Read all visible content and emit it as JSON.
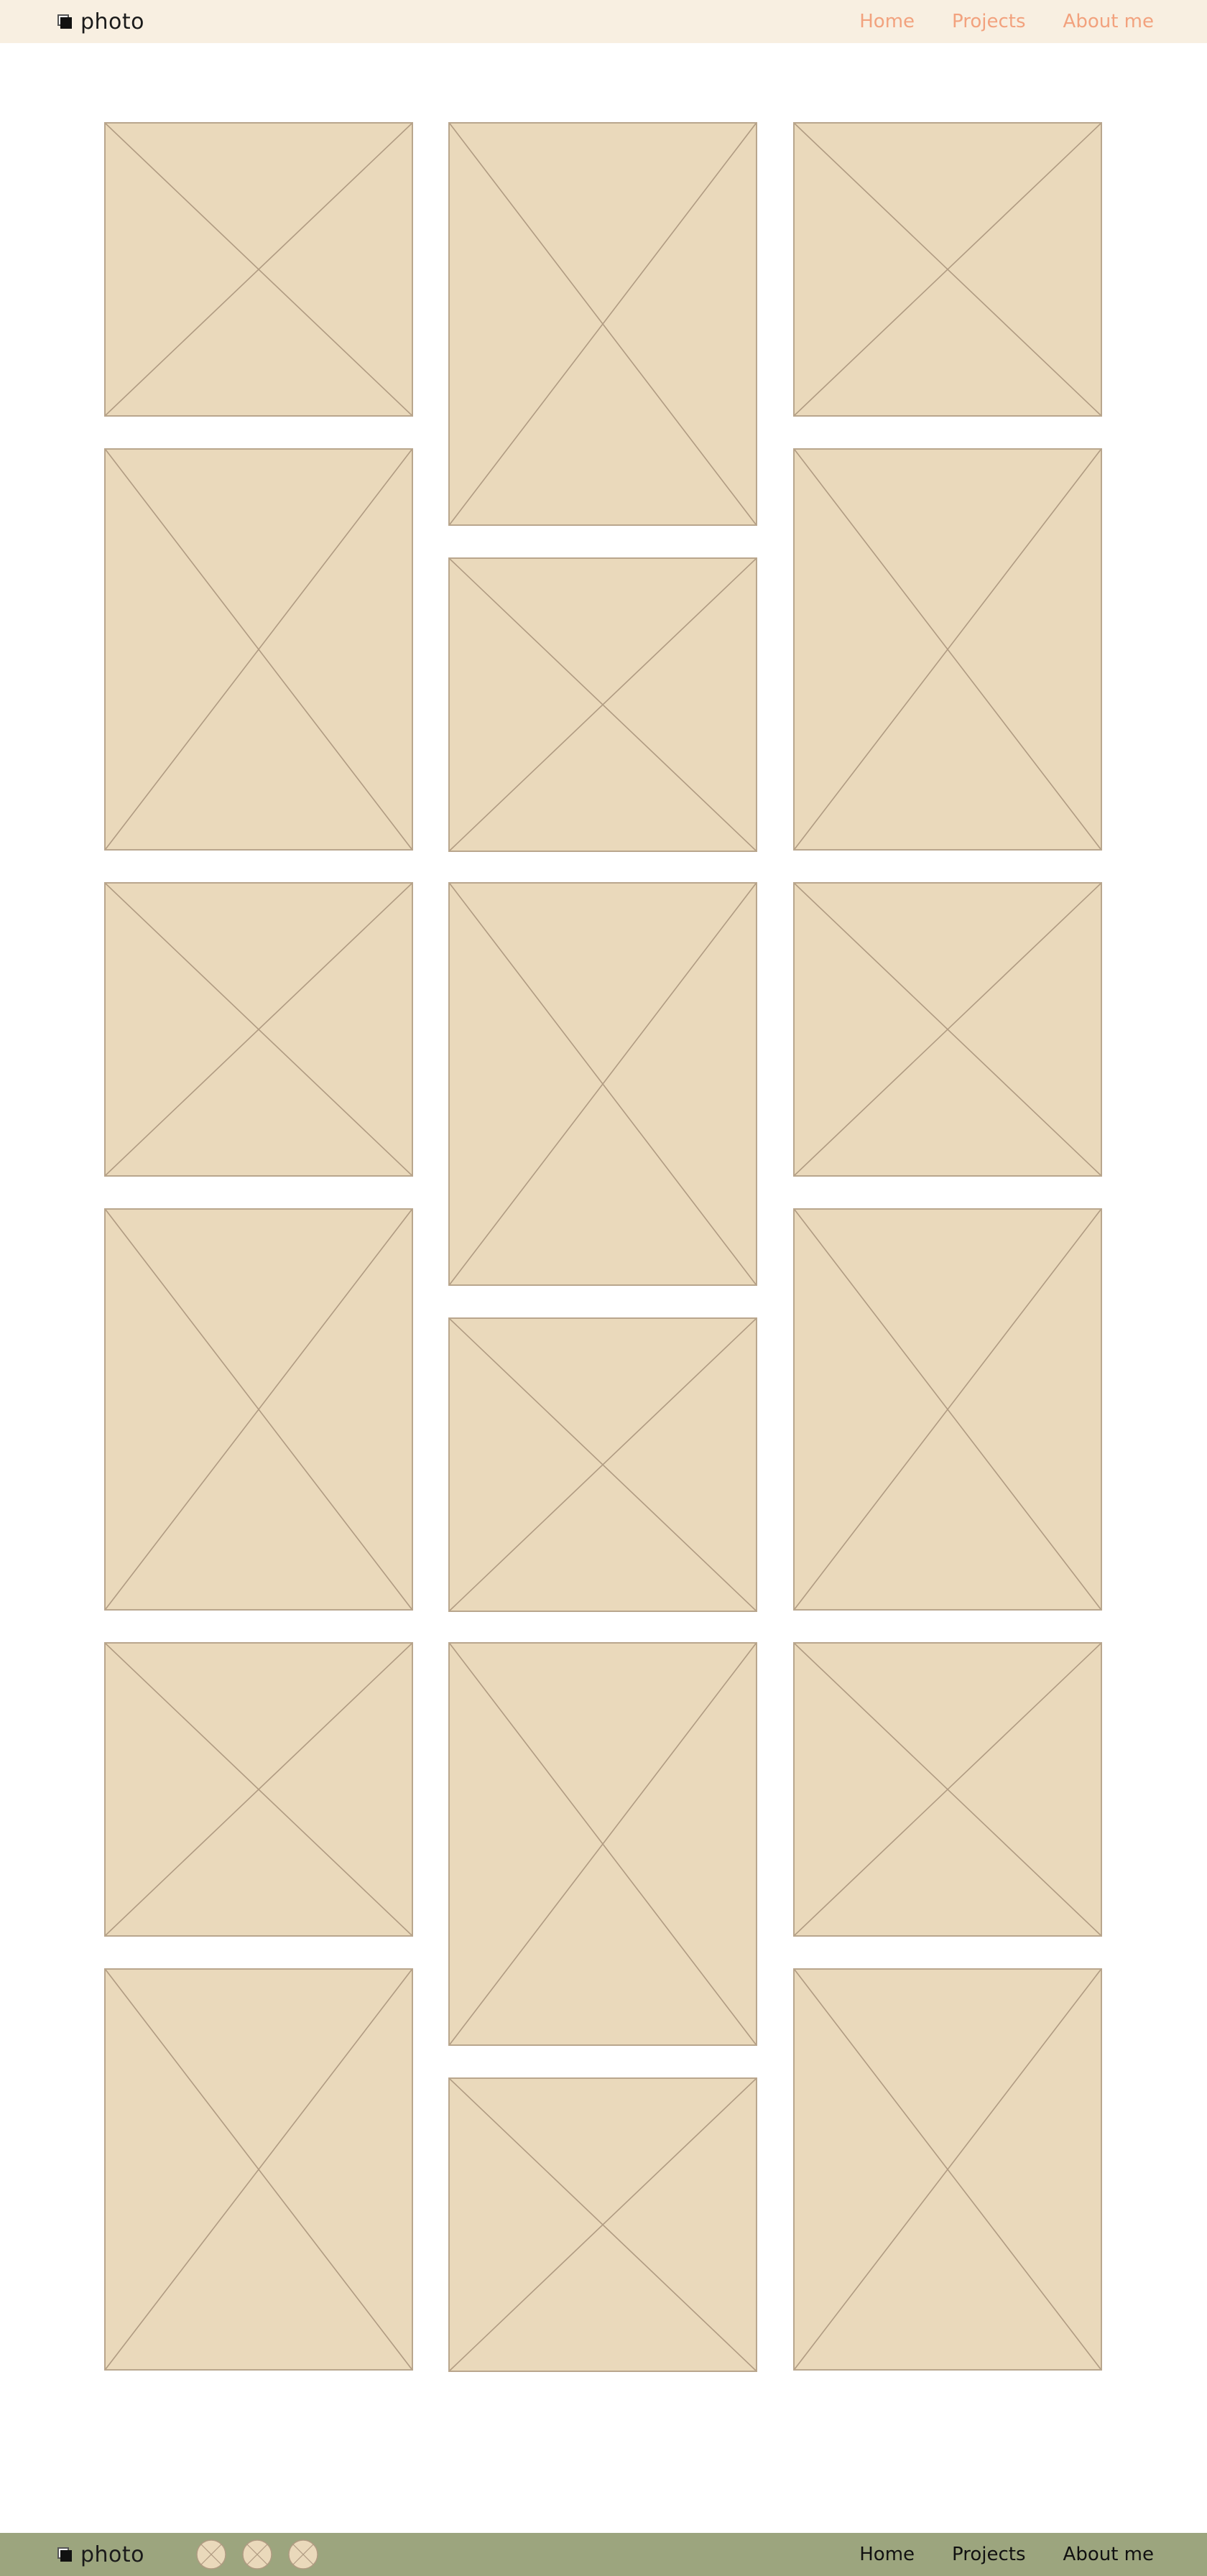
{
  "header": {
    "logo_text": "photo",
    "nav": [
      "Home",
      "Projects",
      "About me"
    ],
    "nav_color": "#f2a27e",
    "background": "#f8efe1"
  },
  "gallery": {
    "image_count": 18,
    "placeholder_fill": "#ead9bb",
    "placeholder_stroke": "#b09b82"
  },
  "footer": {
    "logo_text": "photo",
    "social_icons": [
      "social-icon-1",
      "social-icon-2",
      "social-icon-3"
    ],
    "nav": [
      "Home",
      "Projects",
      "About me"
    ],
    "background": "#9ca57e"
  }
}
